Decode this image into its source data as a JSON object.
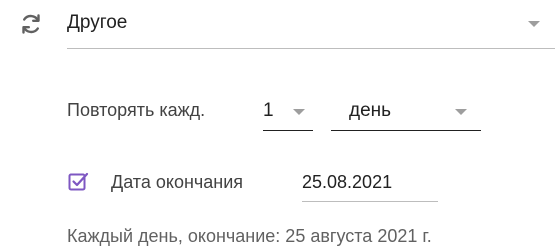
{
  "recurrence": {
    "type_value": "Другое"
  },
  "repeat_every": {
    "label": "Повторять кажд.",
    "interval": "1",
    "unit": "день"
  },
  "end_date": {
    "checked": true,
    "label": "Дата окончания",
    "value": "25.08.2021"
  },
  "summary": "Каждый день, окончание: 25 августа 2021 г.",
  "colors": {
    "accent": "#7e57c2",
    "icon": "#616161",
    "underline": "#bdbdbd",
    "dark_underline": "#212121"
  },
  "icons": {
    "repeat": "sync-icon",
    "checkbox": "checkbox-checked-icon",
    "dropdown": "dropdown-arrow-icon"
  }
}
